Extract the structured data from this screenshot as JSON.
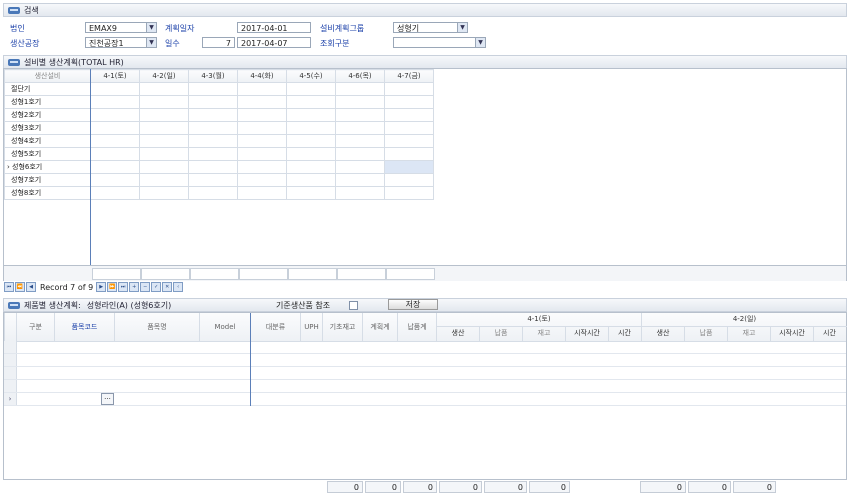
{
  "search_panel": {
    "title": "검색",
    "corp_label": "법인",
    "corp_value": "EMAX9",
    "factory_label": "생산공장",
    "factory_value": "진천공장1",
    "plan_date_label": "계획일자",
    "plan_date_from": "2017-04-01",
    "days_label": "일수",
    "days_value": "7",
    "plan_date_to": "2017-04-07",
    "equip_group_label": "설비계획그룹",
    "equip_group_value": "성형기",
    "lookup_label": "조회구분",
    "lookup_value": ""
  },
  "equip_panel": {
    "title": "설비별 생산계획(TOTAL HR)",
    "columns": [
      "생산설비",
      "4-1(토)",
      "4-2(일)",
      "4-3(월)",
      "4-4(화)",
      "4-5(수)",
      "4-6(목)",
      "4-7(금)"
    ],
    "rows": [
      "절단기",
      "성형1호기",
      "성형2호기",
      "성형3호기",
      "성형4호기",
      "성형5호기",
      "성형6호기",
      "성형7호기",
      "성형8호기"
    ]
  },
  "nav": {
    "record_text": "Record 7 of 9"
  },
  "product_panel": {
    "title": "제품별 생산계획:",
    "line_text": "성형라인(A) (성형6호기)",
    "reference_label": "기준생산품 참조",
    "save_label": "저장",
    "columns": [
      "구분",
      "품목코드",
      "품목명",
      "Model",
      "대분류",
      "UPH",
      "기초재고",
      "계획계",
      "납품계"
    ],
    "day1_label": "4-1(토)",
    "day2_label": "4-2(일)",
    "sub_columns": [
      "생산",
      "납품",
      "재고",
      "시작시간",
      "시간"
    ],
    "ellipsis": "..."
  },
  "footer_values": [
    "0",
    "0",
    "0",
    "0",
    "0",
    "0",
    "0",
    "0",
    "0"
  ]
}
